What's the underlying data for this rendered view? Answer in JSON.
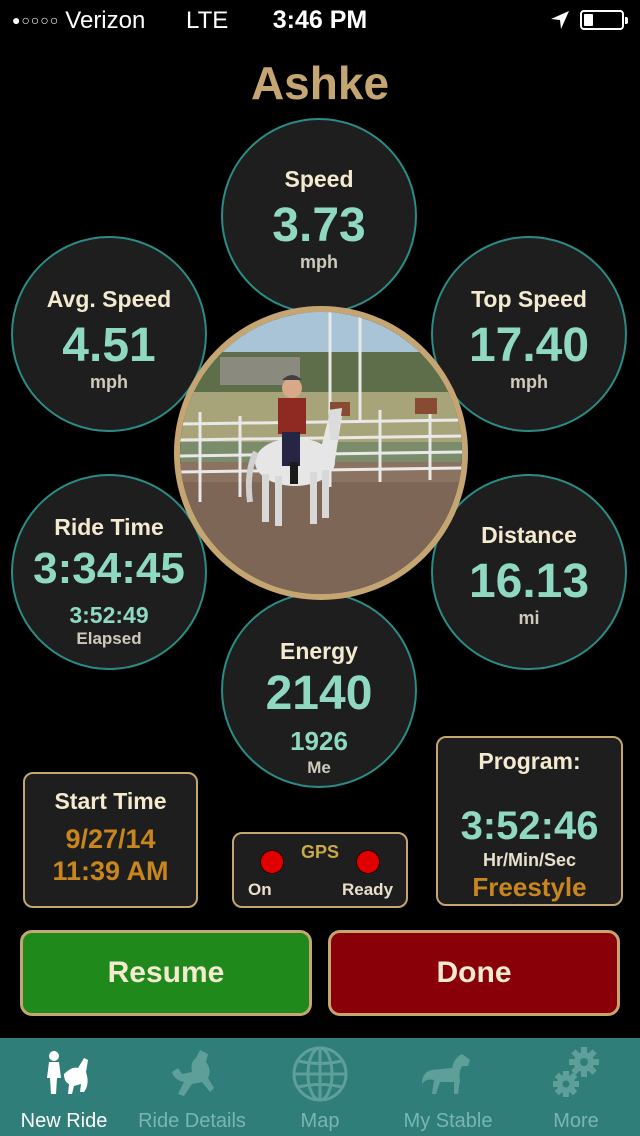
{
  "status_bar": {
    "signal_dots": "●○○○○",
    "carrier": "Verizon",
    "network": "LTE",
    "time": "3:46 PM",
    "battery_level": 0.25
  },
  "title": "Ashke",
  "metrics": {
    "speed": {
      "label": "Speed",
      "value": "3.73",
      "unit": "mph"
    },
    "avg_speed": {
      "label": "Avg. Speed",
      "value": "4.51",
      "unit": "mph"
    },
    "top_speed": {
      "label": "Top Speed",
      "value": "17.40",
      "unit": "mph"
    },
    "ride_time": {
      "label": "Ride Time",
      "value": "3:34:45",
      "sub": "3:52:49",
      "unit": "Elapsed"
    },
    "distance": {
      "label": "Distance",
      "value": "16.13",
      "unit": "mi"
    },
    "energy": {
      "label": "Energy",
      "value": "2140",
      "sub": "1926",
      "unit": "Me"
    }
  },
  "start_time": {
    "label": "Start Time",
    "date": "9/27/14",
    "time": "11:39 AM"
  },
  "gps": {
    "label": "GPS",
    "on_label": "On",
    "ready_label": "Ready",
    "indicator_color": "#e00000"
  },
  "program": {
    "label": "Program:",
    "time": "3:52:46",
    "unit": "Hr/Min/Sec",
    "mode": "Freestyle"
  },
  "buttons": {
    "resume": "Resume",
    "done": "Done"
  },
  "tabs": [
    {
      "label": "New Ride",
      "icon": "rider-horse-icon",
      "active": true
    },
    {
      "label": "Ride Details",
      "icon": "rearing-horse-icon",
      "active": false
    },
    {
      "label": "Map",
      "icon": "globe-icon",
      "active": false
    },
    {
      "label": "My Stable",
      "icon": "horse-icon",
      "active": false
    },
    {
      "label": "More",
      "icon": "gears-icon",
      "active": false
    }
  ],
  "colors": {
    "accent_gold": "#c5a572",
    "value_teal": "#8fd8c2",
    "tabbar": "#2f7e7a"
  }
}
